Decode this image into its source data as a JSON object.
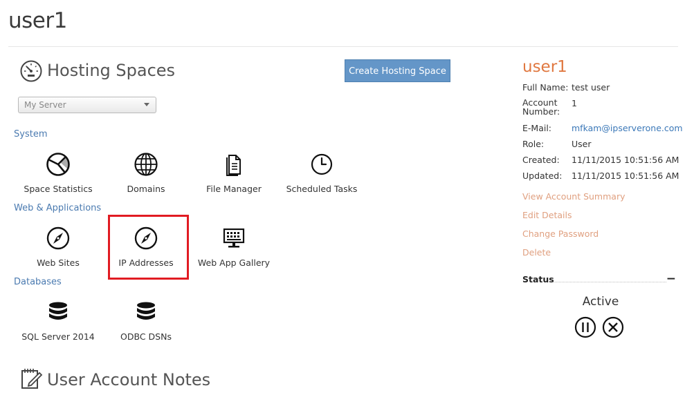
{
  "page": {
    "title": "user1"
  },
  "hosting": {
    "heading": "Hosting Spaces",
    "create_button": "Create Hosting Space",
    "server_select": "My Server"
  },
  "groups": [
    {
      "label": "System",
      "items": [
        {
          "label": "Space Statistics",
          "icon": "pie-chart-icon"
        },
        {
          "label": "Domains",
          "icon": "globe-icon"
        },
        {
          "label": "File Manager",
          "icon": "file-icon"
        },
        {
          "label": "Scheduled Tasks",
          "icon": "clock-icon"
        }
      ]
    },
    {
      "label": "Web & Applications",
      "items": [
        {
          "label": "Web Sites",
          "icon": "compass-icon"
        },
        {
          "label": "IP Addresses",
          "icon": "compass-icon"
        },
        {
          "label": "Web App Gallery",
          "icon": "monitor-grid-icon"
        }
      ]
    },
    {
      "label": "Databases",
      "items": [
        {
          "label": "SQL Server 2014",
          "icon": "database-icon"
        },
        {
          "label": "ODBC DSNs",
          "icon": "database-icon"
        }
      ]
    }
  ],
  "notes": {
    "heading": "User Account Notes"
  },
  "sidebar": {
    "username": "user1",
    "info": [
      {
        "label": "Full Name:",
        "value": "test user"
      },
      {
        "label": "Account Number:",
        "value": "1"
      },
      {
        "label": "E-Mail:",
        "value": "mfkam@ipserverone.com"
      },
      {
        "label": "Role:",
        "value": "User"
      },
      {
        "label": "Created:",
        "value": "11/11/2015 10:51:56 AM"
      },
      {
        "label": "Updated:",
        "value": "11/11/2015 10:51:56 AM"
      }
    ],
    "actions": [
      "View Account Summary",
      "Edit Details",
      "Change Password",
      "Delete"
    ],
    "status": {
      "heading": "Status",
      "collapse": "−",
      "value": "Active"
    }
  },
  "colors": {
    "accent": "#6496c8",
    "link": "#4a7ab0",
    "user": "#e07840",
    "action": "#e0a080",
    "highlight": "#e11b22"
  }
}
